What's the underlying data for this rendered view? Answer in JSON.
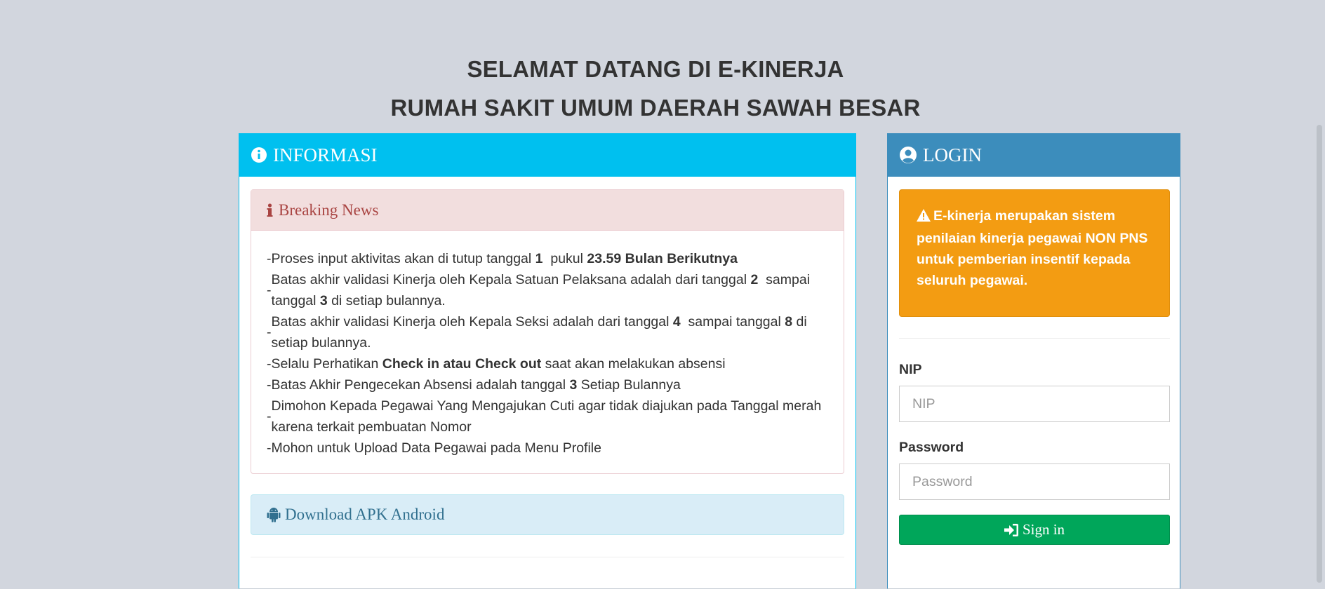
{
  "titles": {
    "line1": "SELAMAT DATANG DI E-KINERJA",
    "line2": "RUMAH SAKIT UMUM DAERAH SAWAH BESAR"
  },
  "info": {
    "header": "INFORMASI",
    "icon": "info-circle-icon",
    "breaking_news": {
      "title": "Breaking News",
      "icon": "info-icon",
      "items": [
        {
          "parts": [
            {
              "t": "Proses input aktivitas akan di tutup tanggal "
            },
            {
              "t": "1",
              "b": true
            },
            {
              "t": "  pukul "
            },
            {
              "t": "23.59 Bulan Berikutnya",
              "b": true
            }
          ]
        },
        {
          "parts": [
            {
              "t": "Batas akhir validasi Kinerja oleh Kepala Satuan Pelaksana adalah dari tanggal "
            },
            {
              "t": "2",
              "b": true
            },
            {
              "t": "  sampai tanggal "
            },
            {
              "t": "3",
              "b": true
            },
            {
              "t": " di setiap bulannya."
            }
          ]
        },
        {
          "parts": [
            {
              "t": "Batas akhir validasi Kinerja oleh Kepala Seksi adalah dari tanggal "
            },
            {
              "t": "4",
              "b": true
            },
            {
              "t": "  sampai tanggal "
            },
            {
              "t": "8",
              "b": true
            },
            {
              "t": " di setiap bulannya."
            }
          ]
        },
        {
          "parts": [
            {
              "t": "Selalu Perhatikan "
            },
            {
              "t": "Check in atau Check out",
              "b": true
            },
            {
              "t": " saat akan melakukan absensi"
            }
          ]
        },
        {
          "parts": [
            {
              "t": "Batas Akhir Pengecekan Absensi adalah tanggal "
            },
            {
              "t": "3",
              "b": true
            },
            {
              "t": " Setiap Bulannya"
            }
          ]
        },
        {
          "parts": [
            {
              "t": "Dimohon Kepada Pegawai Yang Mengajukan Cuti agar tidak diajukan pada Tanggal merah karena terkait pembuatan Nomor"
            }
          ]
        },
        {
          "parts": [
            {
              "t": "Mohon untuk Upload Data Pegawai pada Menu Profile"
            }
          ]
        }
      ]
    },
    "download": {
      "label": "Download APK Android",
      "icon": "android-icon"
    }
  },
  "login": {
    "header": "LOGIN",
    "icon": "user-circle-icon",
    "alert_icon": "warning-icon",
    "alert_text": "E-kinerja merupakan sistem penilaian kinerja pegawai NON PNS untuk pemberian insentif kepada seluruh pegawai.",
    "nip_label": "NIP",
    "nip_placeholder": "NIP",
    "password_label": "Password",
    "password_placeholder": "Password",
    "submit_label": "Sign in",
    "submit_icon": "sign-in-icon"
  },
  "colors": {
    "background": "#d2d6de",
    "info_header": "#00c0ef",
    "login_header": "#3c8dbc",
    "alert_warning": "#f39c12",
    "button_success": "#00a65a",
    "news_header_bg": "#f2dede",
    "news_header_text": "#a94442",
    "apk_bg": "#d9edf7",
    "apk_text": "#31708f"
  }
}
